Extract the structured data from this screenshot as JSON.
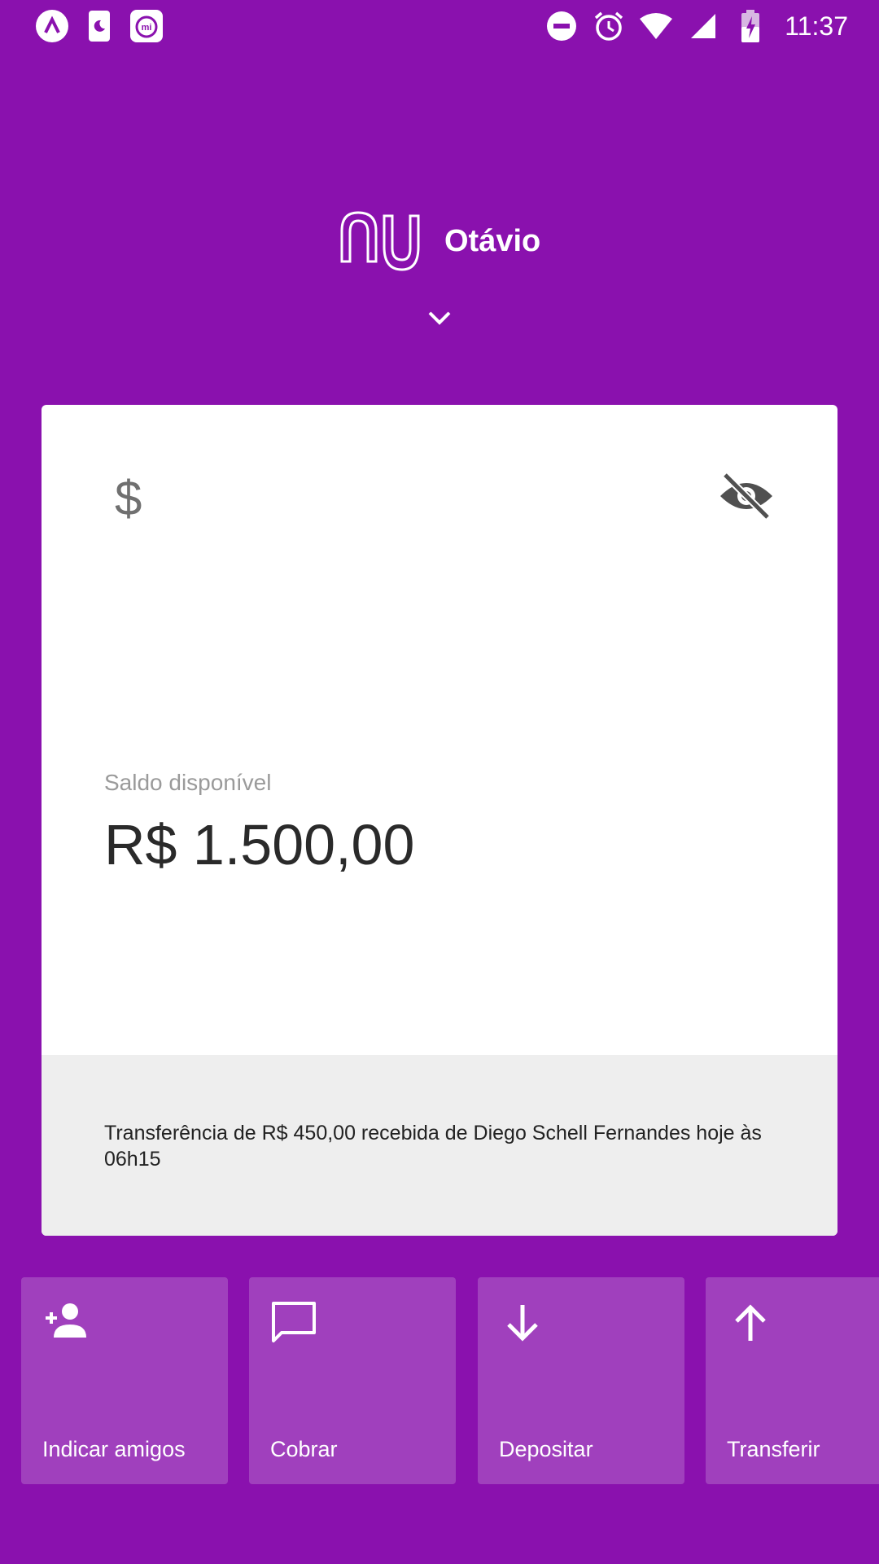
{
  "status_bar": {
    "time": "11:37",
    "left_icons": [
      "notification-app-icon",
      "night-mode-icon",
      "mi-app-icon"
    ],
    "right_icons": [
      "do-not-disturb-icon",
      "alarm-icon",
      "wifi-icon",
      "signal-icon",
      "battery-charging-icon"
    ]
  },
  "header": {
    "logo": "nu",
    "user_name": "Otávio"
  },
  "card": {
    "balance_label": "Saldo disponível",
    "balance_value": "R$ 1.500,00",
    "currency_symbol": "$",
    "notification": "Transferência de R$ 450,00 recebida de Diego Schell Fernandes hoje às 06h15"
  },
  "actions": [
    {
      "label": "Indicar amigos",
      "icon": "add-person-icon"
    },
    {
      "label": "Cobrar",
      "icon": "message-icon"
    },
    {
      "label": "Depositar",
      "icon": "arrow-down-icon"
    },
    {
      "label": "Transferir",
      "icon": "arrow-up-icon"
    }
  ],
  "colors": {
    "background": "#8a11ae",
    "action_tile": "#a040bd",
    "card": "#ffffff",
    "card_footer": "#eeeeee"
  }
}
